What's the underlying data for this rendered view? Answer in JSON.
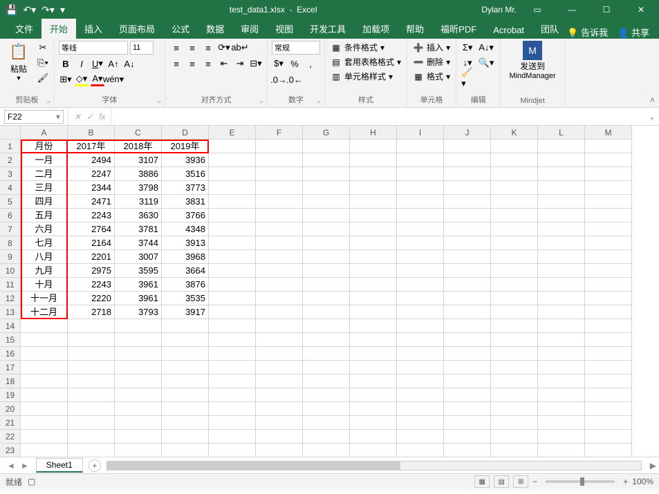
{
  "title": {
    "filename": "test_data1.xlsx",
    "app": "Excel"
  },
  "user": "Dylan Mr.",
  "tabs": {
    "file": "文件",
    "home": "开始",
    "insert": "插入",
    "layout": "页面布局",
    "formulas": "公式",
    "data": "数据",
    "review": "审阅",
    "view": "视图",
    "dev": "开发工具",
    "addins": "加载项",
    "help": "帮助",
    "foxit": "福昕PDF",
    "acrobat": "Acrobat",
    "team": "团队",
    "tellme": "告诉我",
    "share": "共享"
  },
  "ribbon": {
    "clipboard": {
      "paste": "粘贴",
      "label": "剪贴板"
    },
    "font": {
      "name": "等线",
      "size": "11",
      "label": "字体"
    },
    "align": {
      "label": "对齐方式"
    },
    "number": {
      "format": "常规",
      "label": "数字"
    },
    "styles": {
      "cond": "条件格式",
      "tbl": "套用表格格式",
      "cell": "单元格样式",
      "label": "样式"
    },
    "cells": {
      "insert": "插入",
      "delete": "删除",
      "format": "格式",
      "label": "单元格"
    },
    "editing": {
      "label": "编辑"
    },
    "mindjet": {
      "send": "发送到",
      "mgr": "MindManager",
      "label": "Mindjet"
    }
  },
  "formula_bar": {
    "name_box": "F22"
  },
  "columns": [
    "A",
    "B",
    "C",
    "D",
    "E",
    "F",
    "G",
    "H",
    "I",
    "J",
    "K",
    "L",
    "M"
  ],
  "row_count": 23,
  "chart_data": {
    "type": "table",
    "headers": [
      "月份",
      "2017年",
      "2018年",
      "2019年"
    ],
    "rows": [
      [
        "一月",
        2494,
        3107,
        3936
      ],
      [
        "二月",
        2247,
        3886,
        3516
      ],
      [
        "三月",
        2344,
        3798,
        3773
      ],
      [
        "四月",
        2471,
        3119,
        3831
      ],
      [
        "五月",
        2243,
        3630,
        3766
      ],
      [
        "六月",
        2764,
        3781,
        4348
      ],
      [
        "七月",
        2164,
        3744,
        3913
      ],
      [
        "八月",
        2201,
        3007,
        3968
      ],
      [
        "九月",
        2975,
        3595,
        3664
      ],
      [
        "十月",
        2243,
        3961,
        3876
      ],
      [
        "十一月",
        2220,
        3961,
        3535
      ],
      [
        "十二月",
        2718,
        3793,
        3917
      ]
    ]
  },
  "sheet": {
    "name": "Sheet1"
  },
  "status": {
    "ready": "就绪",
    "zoom": "100%"
  }
}
